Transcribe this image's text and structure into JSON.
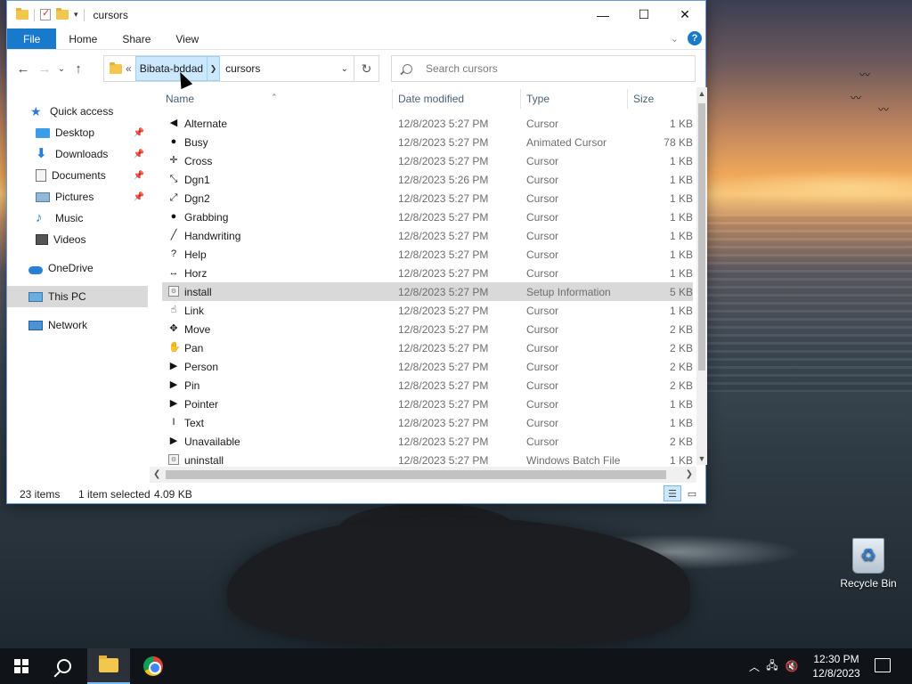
{
  "window": {
    "title": "cursors",
    "controls": {
      "minimize": "—",
      "maximize": "☐",
      "close": "✕"
    }
  },
  "ribbon": {
    "tabs": [
      "File",
      "Home",
      "Share",
      "View"
    ]
  },
  "address": {
    "overflow": "«",
    "crumbs": [
      "Bibata-bddad",
      "cursors"
    ],
    "search_placeholder": "Search cursors"
  },
  "nav": {
    "quick_access": "Quick access",
    "pinned": [
      {
        "label": "Desktop",
        "icon": "desktop-icon"
      },
      {
        "label": "Downloads",
        "icon": "download-icon"
      },
      {
        "label": "Documents",
        "icon": "documents-icon"
      },
      {
        "label": "Pictures",
        "icon": "pictures-icon"
      }
    ],
    "unpinned": [
      {
        "label": "Music",
        "icon": "music-icon"
      },
      {
        "label": "Videos",
        "icon": "videos-icon"
      }
    ],
    "onedrive": "OneDrive",
    "this_pc": "This PC",
    "network": "Network"
  },
  "columns": {
    "name": "Name",
    "date": "Date modified",
    "type": "Type",
    "size": "Size"
  },
  "files": [
    {
      "name": "Alternate",
      "date": "12/8/2023 5:27 PM",
      "type": "Cursor",
      "size": "1 KB",
      "glyph": "◀"
    },
    {
      "name": "Busy",
      "date": "12/8/2023 5:27 PM",
      "type": "Animated Cursor",
      "size": "78 KB",
      "glyph": "●"
    },
    {
      "name": "Cross",
      "date": "12/8/2023 5:27 PM",
      "type": "Cursor",
      "size": "1 KB",
      "glyph": "✛"
    },
    {
      "name": "Dgn1",
      "date": "12/8/2023 5:26 PM",
      "type": "Cursor",
      "size": "1 KB",
      "glyph": "⤡"
    },
    {
      "name": "Dgn2",
      "date": "12/8/2023 5:27 PM",
      "type": "Cursor",
      "size": "1 KB",
      "glyph": "⤢"
    },
    {
      "name": "Grabbing",
      "date": "12/8/2023 5:27 PM",
      "type": "Cursor",
      "size": "1 KB",
      "glyph": "●"
    },
    {
      "name": "Handwriting",
      "date": "12/8/2023 5:27 PM",
      "type": "Cursor",
      "size": "1 KB",
      "glyph": "╱"
    },
    {
      "name": "Help",
      "date": "12/8/2023 5:27 PM",
      "type": "Cursor",
      "size": "1 KB",
      "glyph": "?"
    },
    {
      "name": "Horz",
      "date": "12/8/2023 5:27 PM",
      "type": "Cursor",
      "size": "1 KB",
      "glyph": "↔"
    },
    {
      "name": "install",
      "date": "12/8/2023 5:27 PM",
      "type": "Setup Information",
      "size": "5 KB",
      "glyph": "⚙"
    },
    {
      "name": "Link",
      "date": "12/8/2023 5:27 PM",
      "type": "Cursor",
      "size": "1 KB",
      "glyph": "☝"
    },
    {
      "name": "Move",
      "date": "12/8/2023 5:27 PM",
      "type": "Cursor",
      "size": "2 KB",
      "glyph": "✥"
    },
    {
      "name": "Pan",
      "date": "12/8/2023 5:27 PM",
      "type": "Cursor",
      "size": "2 KB",
      "glyph": "✋"
    },
    {
      "name": "Person",
      "date": "12/8/2023 5:27 PM",
      "type": "Cursor",
      "size": "2 KB",
      "glyph": "▶"
    },
    {
      "name": "Pin",
      "date": "12/8/2023 5:27 PM",
      "type": "Cursor",
      "size": "2 KB",
      "glyph": "▶"
    },
    {
      "name": "Pointer",
      "date": "12/8/2023 5:27 PM",
      "type": "Cursor",
      "size": "1 KB",
      "glyph": "▶"
    },
    {
      "name": "Text",
      "date": "12/8/2023 5:27 PM",
      "type": "Cursor",
      "size": "1 KB",
      "glyph": "I"
    },
    {
      "name": "Unavailable",
      "date": "12/8/2023 5:27 PM",
      "type": "Cursor",
      "size": "2 KB",
      "glyph": "▶"
    },
    {
      "name": "uninstall",
      "date": "12/8/2023 5:27 PM",
      "type": "Windows Batch File",
      "size": "1 KB",
      "glyph": "⚙"
    }
  ],
  "selected_file": "install",
  "status": {
    "count": "23 items",
    "selection": "1 item selected",
    "size": "4.09 KB"
  },
  "desktop": {
    "recycle_bin": "Recycle Bin"
  },
  "taskbar": {
    "time": "12:30 PM",
    "date": "12/8/2023"
  },
  "colors": {
    "accent": "#1979ca",
    "selection": "#d9d9d9",
    "breadcrumb_highlight": "#cce8ff"
  }
}
